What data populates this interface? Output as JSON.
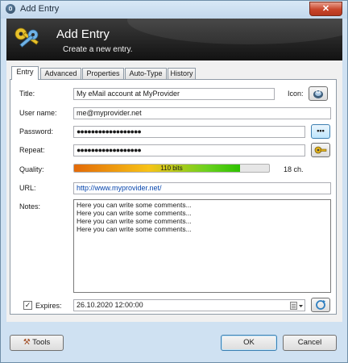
{
  "window": {
    "title": "Add Entry"
  },
  "banner": {
    "title": "Add Entry",
    "subtitle": "Create a new entry."
  },
  "tabs": [
    "Entry",
    "Advanced",
    "Properties",
    "Auto-Type",
    "History"
  ],
  "form": {
    "title_label": "Title:",
    "title_value": "My eMail account at MyProvider",
    "icon_label": "Icon:",
    "username_label": "User name:",
    "username_value": "me@myprovider.net",
    "password_label": "Password:",
    "password_value": "●●●●●●●●●●●●●●●●●●",
    "repeat_label": "Repeat:",
    "repeat_value": "●●●●●●●●●●●●●●●●●●",
    "show_password_label": "•••",
    "quality_label": "Quality:",
    "quality_text": "110 bits",
    "quality_fraction": 0.85,
    "length_text": "18 ch.",
    "url_label": "URL:",
    "url_value": "http://www.myprovider.net/",
    "notes_label": "Notes:",
    "notes_lines": [
      "Here you can write some comments...",
      "Here you can write some comments...",
      "Here you can write some comments...",
      "Here you can write some comments..."
    ],
    "expires_checked": true,
    "expires_check_glyph": "✓",
    "expires_label": "Expires:",
    "expires_value": "26.10.2020 12:00:00"
  },
  "buttons": {
    "tools": "Tools",
    "ok": "OK",
    "cancel": "Cancel"
  },
  "colors": {
    "url_link": "#0645ad",
    "banner_bg": "#1e1e1e",
    "window_frame": "#cfe1f2"
  },
  "icons": [
    "lock-icon",
    "keys-icon",
    "key-icon",
    "date-picker-icon",
    "refresh-icon",
    "tools-icon"
  ]
}
